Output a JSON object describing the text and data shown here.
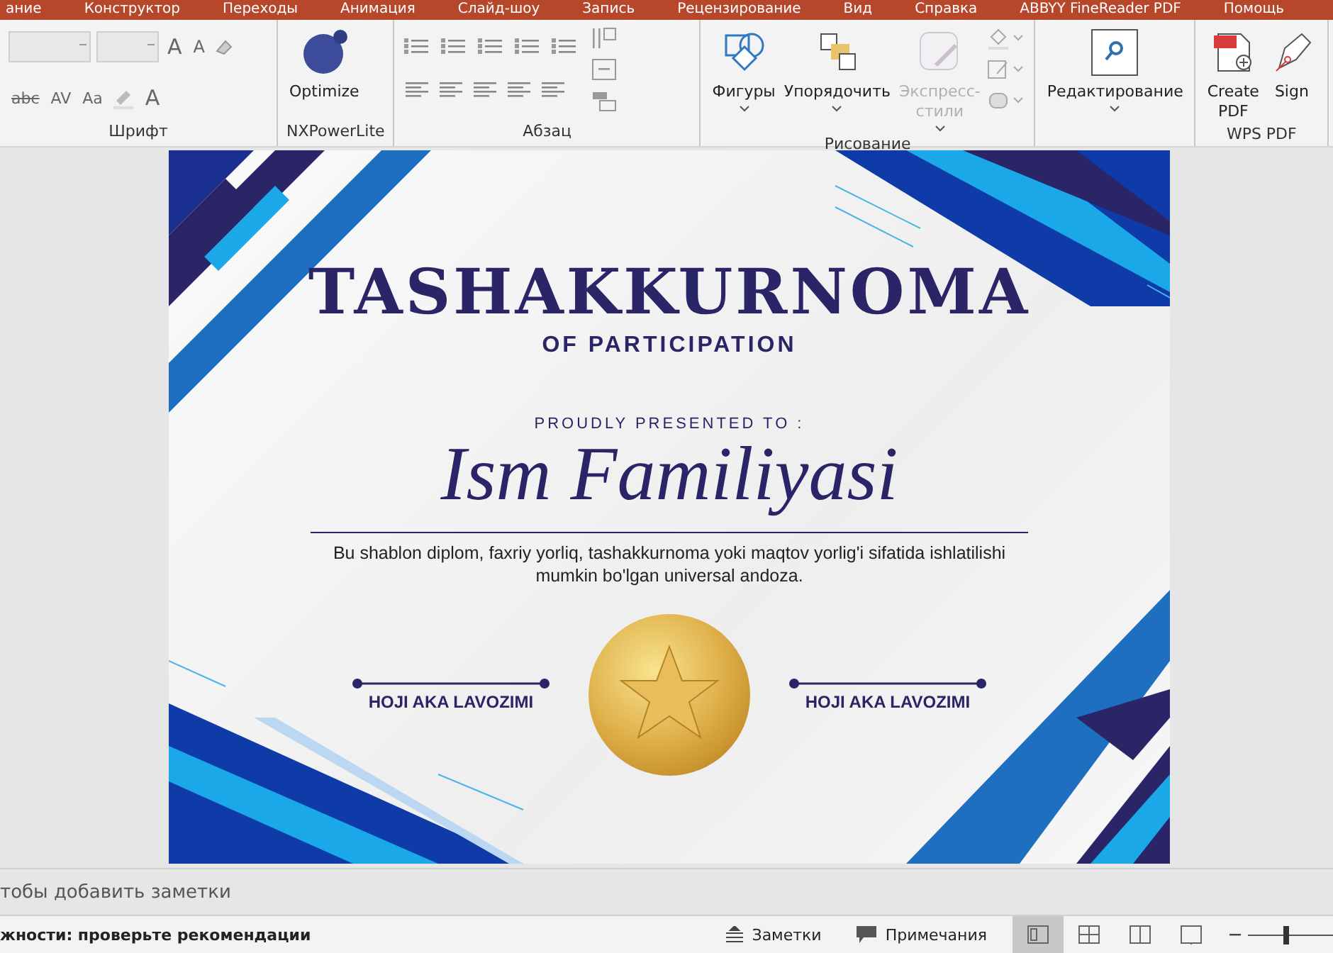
{
  "tabs": [
    {
      "label": "ание"
    },
    {
      "label": "Конструктор"
    },
    {
      "label": "Переходы"
    },
    {
      "label": "Анимация"
    },
    {
      "label": "Слайд-шоу"
    },
    {
      "label": "Запись"
    },
    {
      "label": "Рецензирование"
    },
    {
      "label": "Вид"
    },
    {
      "label": "Справка"
    },
    {
      "label": "ABBYY FineReader PDF"
    },
    {
      "label": "Помощь"
    }
  ],
  "ribbon": [
    {
      "kind": "font",
      "label": "Шрифт",
      "glyphs": [
        "A",
        "A",
        "abc",
        "AV",
        "Aa",
        "A"
      ]
    },
    {
      "kind": "buttons",
      "label": "NXPowerLite",
      "buttons": [
        {
          "label": "Optimize",
          "disabled": false,
          "dropdown": false
        }
      ]
    },
    {
      "kind": "paragraph",
      "label": "Абзац"
    },
    {
      "kind": "buttons",
      "label": "Рисование",
      "buttons": [
        {
          "label": "Фигуры",
          "disabled": false,
          "dropdown": true
        },
        {
          "label": "Упорядочить",
          "disabled": false,
          "dropdown": true
        },
        {
          "label": "Экспресс-стили",
          "disabled": true,
          "dropdown": true
        }
      ]
    },
    {
      "kind": "buttons",
      "buttons": [
        {
          "label": "Редактирование",
          "disabled": false,
          "dropdown": true
        }
      ]
    },
    {
      "kind": "buttons",
      "label": "WPS PDF",
      "buttons": [
        {
          "label": "Create PDF",
          "disabled": false,
          "dropdown": false
        },
        {
          "label": "Sign",
          "disabled": false,
          "dropdown": false
        }
      ]
    }
  ],
  "slide": {
    "title": "TASHAKKURNOMA",
    "subtitle": "OF PARTICIPATION",
    "presented": "PROUDLY PRESENTED TO :",
    "name": "Ism Familiyasi",
    "description": "Bu shablon diplom, faxriy yorliq, tashakkurnoma yoki maqtov yorlig'i sifatida ishlatilishi mumkin bo'lgan universal andoza.",
    "signatures": [
      {
        "label": "HOJI AKA LAVOZIMI"
      },
      {
        "label": "HOJI AKA LAVOZIMI"
      }
    ]
  },
  "notes": {
    "placeholder": "тобы добавить заметки"
  },
  "status_bar": {
    "message": "жности: проверьте рекомендации",
    "buttons": [
      {
        "label": "Заметки"
      },
      {
        "label": "Примечания"
      }
    ],
    "views": [
      {
        "selected": true
      },
      {
        "selected": false
      },
      {
        "selected": false
      },
      {
        "selected": false
      }
    ],
    "zoom": {
      "level": 0.45
    }
  }
}
